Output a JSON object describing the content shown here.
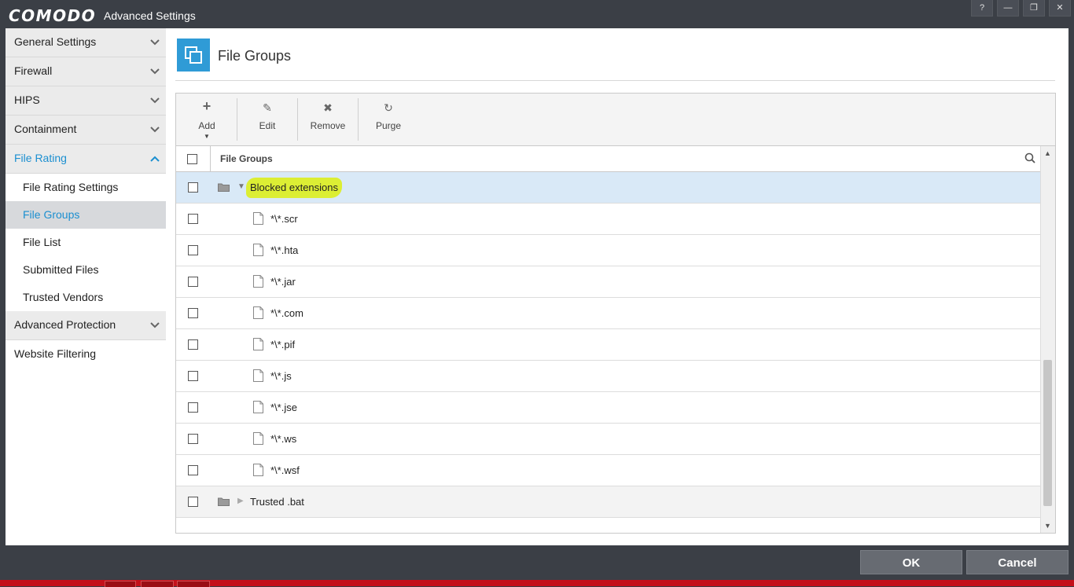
{
  "window": {
    "brand": "COMODO",
    "title": "Advanced Settings",
    "buttons": [
      "?",
      "—",
      "❐",
      "✕"
    ]
  },
  "sidebar": {
    "items": [
      {
        "label": "General Settings",
        "state": "collapsed"
      },
      {
        "label": "Firewall",
        "state": "collapsed"
      },
      {
        "label": "HIPS",
        "state": "collapsed"
      },
      {
        "label": "Containment",
        "state": "collapsed"
      },
      {
        "label": "File Rating",
        "state": "expanded"
      },
      {
        "label": "Advanced Protection",
        "state": "collapsed"
      },
      {
        "label": "Website Filtering",
        "state": "none"
      }
    ],
    "file_rating_children": [
      "File Rating Settings",
      "File Groups",
      "File List",
      "Submitted Files",
      "Trusted Vendors"
    ],
    "selected_child": "File Groups"
  },
  "page": {
    "title": "File Groups",
    "accent_color": "#2f9bd6"
  },
  "toolbar": {
    "add": "Add",
    "edit": "Edit",
    "remove": "Remove",
    "purge": "Purge"
  },
  "table": {
    "header": "File Groups",
    "groups": [
      {
        "name": "Blocked extensions",
        "expanded": true,
        "files": [
          "*\\*.scr",
          "*\\*.hta",
          "*\\*.jar",
          "*\\*.com",
          "*\\*.pif",
          "*\\*.js",
          "*\\*.jse",
          "*\\*.ws",
          "*\\*.wsf"
        ]
      },
      {
        "name": "Trusted .bat",
        "expanded": false,
        "files": []
      }
    ]
  },
  "footer": {
    "ok": "OK",
    "cancel": "Cancel"
  }
}
